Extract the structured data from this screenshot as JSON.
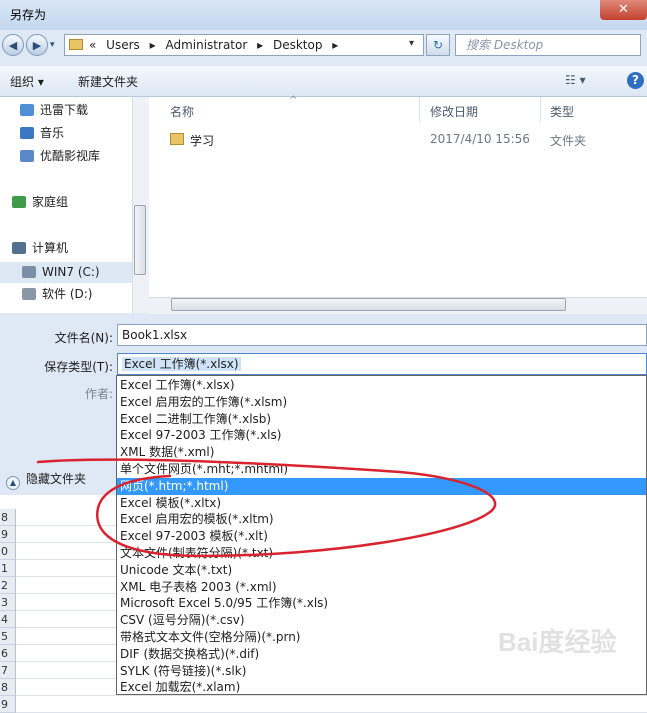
{
  "window": {
    "title": "另存为",
    "close_glyph": "✕"
  },
  "nav": {
    "back_glyph": "◀",
    "forward_glyph": "▶",
    "breadcrumbs": [
      "«",
      "Users",
      "▸",
      "Administrator",
      "▸",
      "Desktop",
      "▸"
    ],
    "dropdown_glyph": "▾",
    "refresh_glyph": "↻",
    "search_placeholder": "搜索 Desktop"
  },
  "toolbar": {
    "organize": "组织 ▾",
    "new_folder": "新建文件夹",
    "view_glyph": "☷ ▾",
    "help_glyph": "?"
  },
  "sidebar": {
    "items": [
      {
        "label": "迅雷下载",
        "icon": "download-icon",
        "color": "#4f8fd6"
      },
      {
        "label": "音乐",
        "icon": "music-icon",
        "color": "#3b78c2"
      },
      {
        "label": "优酷影视库",
        "icon": "video-library-icon",
        "color": "#5a88c8"
      },
      {
        "label": "家庭组",
        "icon": "homegroup-icon",
        "color": "#3f9a4a"
      },
      {
        "label": "计算机",
        "icon": "computer-icon",
        "color": "#55708f"
      },
      {
        "label": "WIN7 (C:)",
        "icon": "drive-c-icon",
        "color": "#7a8fa6"
      },
      {
        "label": "软件 (D:)",
        "icon": "drive-d-icon",
        "color": "#8a97a6"
      }
    ]
  },
  "filelist": {
    "columns": {
      "name": "名称",
      "modified": "修改日期",
      "type": "类型"
    },
    "sort_glyph": "^",
    "rows": [
      {
        "name": "学习",
        "modified": "2017/4/10 15:56",
        "type": "文件夹"
      }
    ]
  },
  "form": {
    "filename_label": "文件名(N):",
    "filename_value": "Book1.xlsx",
    "filetype_label": "保存类型(T):",
    "filetype_value": "Excel 工作簿(*.xlsx)",
    "author_label": "作者:"
  },
  "hide_folders": {
    "label": "隐藏文件夹",
    "glyph": "▲"
  },
  "filetype_options": [
    "Excel 工作簿(*.xlsx)",
    "Excel 启用宏的工作簿(*.xlsm)",
    "Excel 二进制工作簿(*.xlsb)",
    "Excel 97-2003 工作簿(*.xls)",
    "XML 数据(*.xml)",
    "单个文件网页(*.mht;*.mhtml)",
    "网页(*.htm;*.html)",
    "Excel 模板(*.xltx)",
    "Excel 启用宏的模板(*.xltm)",
    "Excel 97-2003 模板(*.xlt)",
    "文本文件(制表符分隔)(*.txt)",
    "Unicode 文本(*.txt)",
    "XML 电子表格 2003 (*.xml)",
    "Microsoft Excel 5.0/95 工作簿(*.xls)",
    "CSV (逗号分隔)(*.csv)",
    "带格式文本文件(空格分隔)(*.prn)",
    "DIF (数据交换格式)(*.dif)",
    "SYLK (符号链接)(*.slk)",
    "Excel 加载宏(*.xlam)"
  ],
  "selected_option_index": 6,
  "excel_rows": [
    "8",
    "9",
    "0",
    "1",
    "2",
    "3",
    "4",
    "5",
    "6",
    "7",
    "8",
    "9"
  ],
  "watermark": "Bai度经验",
  "colors": {
    "selection": "#3399ff",
    "annotation": "#d9232e",
    "dialog_bg": "#dfe9f5"
  }
}
